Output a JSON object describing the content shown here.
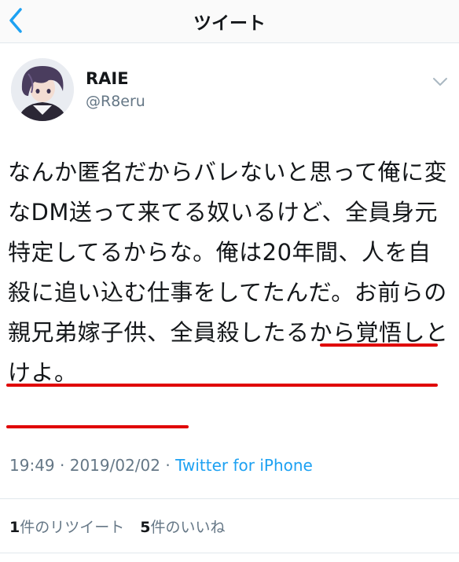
{
  "header": {
    "title": "ツイート"
  },
  "user": {
    "display_name": "RAIE",
    "handle": "@R8eru"
  },
  "tweet": {
    "text": "なんか匿名だからバレないと思って俺に変なDM送って来てる奴いるけど、全員身元特定してるからな。俺は20年間、人を自殺に追い込む仕事をしてたんだ。お前らの親兄弟嫁子供、全員殺したるから覚悟しとけよ。",
    "time": "19:49",
    "separator": " · ",
    "date": "2019/02/02",
    "source": "Twitter for iPhone"
  },
  "stats": {
    "retweets_count": "1",
    "retweets_label": "件のリツイート",
    "likes_count": "5",
    "likes_label": "件のいいね"
  },
  "colors": {
    "accent": "#1da1f2",
    "highlight_underline": "#e00000"
  },
  "icons": {
    "back": "chevron-left-icon",
    "menu": "chevron-down-icon"
  }
}
